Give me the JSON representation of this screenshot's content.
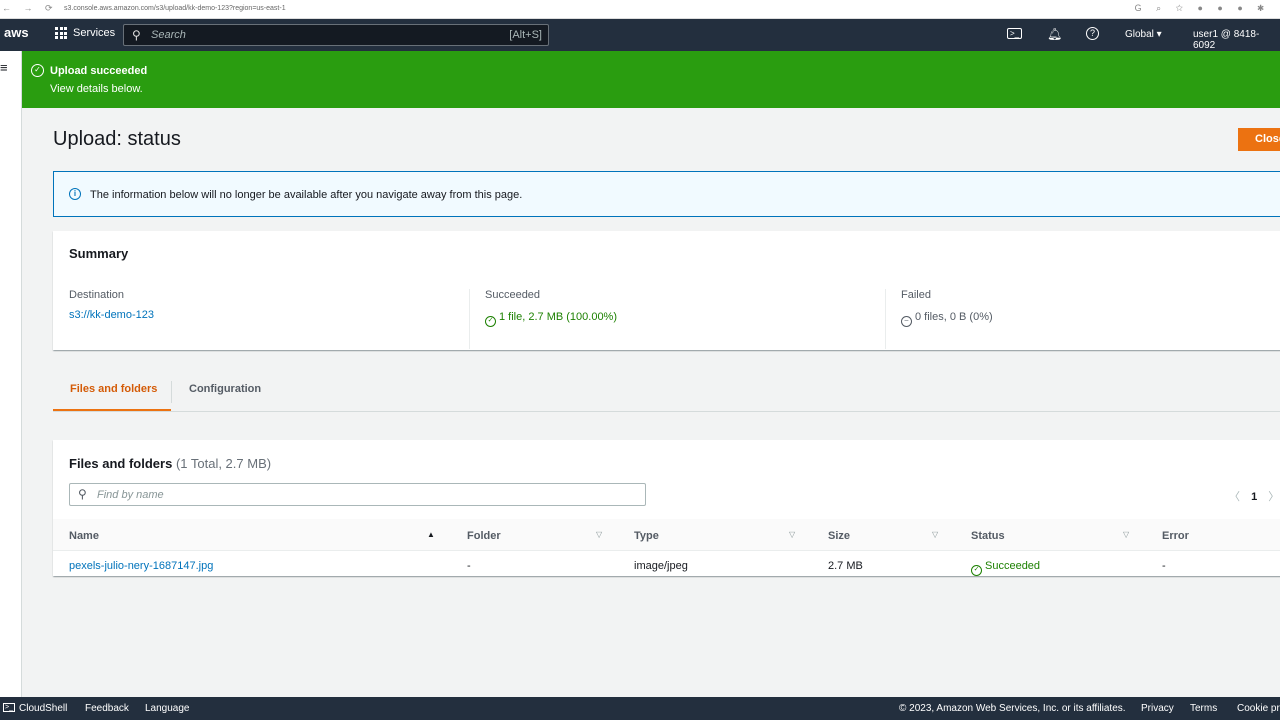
{
  "browser": {
    "url": "s3.console.aws.amazon.com/s3/upload/kk-demo-123?region=us-east-1"
  },
  "topnav": {
    "logo": "aws",
    "services": "Services",
    "search_placeholder": "Search",
    "search_shortcut": "[Alt+S]",
    "region": "Global",
    "account": "user1 @ 8418-6092"
  },
  "flash": {
    "title": "Upload succeeded",
    "subtitle": "View details below."
  },
  "page": {
    "title": "Upload: status",
    "close": "Close"
  },
  "info": {
    "text": "The information below will no longer be available after you navigate away from this page."
  },
  "summary": {
    "title": "Summary",
    "destination_label": "Destination",
    "destination": "s3://kk-demo-123",
    "succeeded_label": "Succeeded",
    "succeeded": "1 file, 2.7 MB (100.00%)",
    "failed_label": "Failed",
    "failed": "0 files, 0 B (0%)"
  },
  "tabs": [
    {
      "label": "Files and folders",
      "active": true
    },
    {
      "label": "Configuration",
      "active": false
    }
  ],
  "files": {
    "title": "Files and folders",
    "count": "(1 Total, 2.7 MB)",
    "find_placeholder": "Find by name",
    "page": "1",
    "columns": [
      "Name",
      "Folder",
      "Type",
      "Size",
      "Status",
      "Error"
    ],
    "rows": [
      {
        "name": "pexels-julio-nery-1687147.jpg",
        "folder": "-",
        "type": "image/jpeg",
        "size": "2.7 MB",
        "status": "Succeeded",
        "error": "-"
      }
    ]
  },
  "footer": {
    "cloudshell": "CloudShell",
    "feedback": "Feedback",
    "language": "Language",
    "copyright": "© 2023, Amazon Web Services, Inc. or its affiliates.",
    "privacy": "Privacy",
    "terms": "Terms",
    "cookies": "Cookie preferences"
  },
  "colors": {
    "nav": "#232f3e",
    "success": "#2a9d10",
    "accent": "#ec7211",
    "link": "#0073bb"
  }
}
